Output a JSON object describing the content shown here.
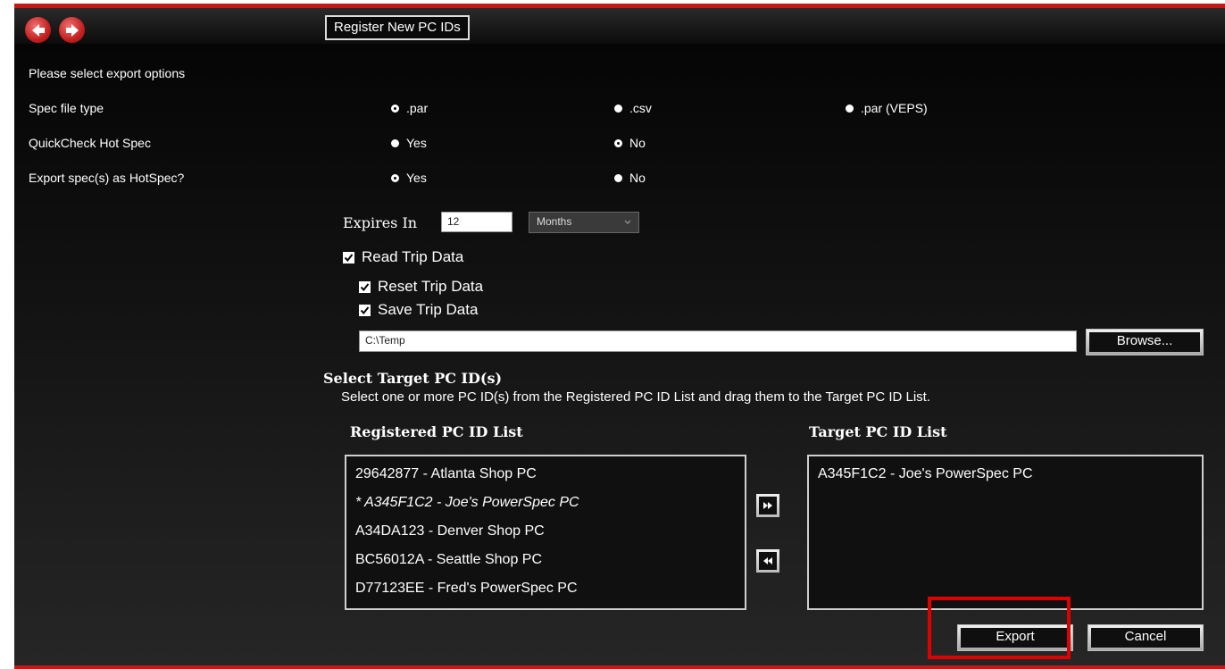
{
  "tab": {
    "title": "Register New PC IDs"
  },
  "options": {
    "heading": "Please select export options",
    "spec_file_type": {
      "label": "Spec file type",
      "choices": [
        ".par",
        ".csv",
        ".par (VEPS)"
      ],
      "selected": ".par"
    },
    "quickcheck_hot_spec": {
      "label": "QuickCheck Hot Spec",
      "choices": [
        "Yes",
        "No"
      ],
      "selected": "No"
    },
    "export_as_hotspec": {
      "label": "Export spec(s) as HotSpec?",
      "choices": [
        "Yes",
        "No"
      ],
      "selected": "Yes"
    }
  },
  "expires": {
    "label": "Expires In",
    "value": "12",
    "unit": "Months"
  },
  "trip": {
    "read": {
      "label": "Read Trip Data",
      "checked": true
    },
    "reset": {
      "label": "Reset Trip Data",
      "checked": true
    },
    "save": {
      "label": "Save Trip Data",
      "checked": true
    },
    "path": "C:\\Temp",
    "browse_label": "Browse..."
  },
  "target_section": {
    "title": "Select Target PC ID(s)",
    "instructions": "Select one or more PC ID(s) from the Registered PC ID List and drag them to the Target PC ID List."
  },
  "registered_list": {
    "title": "Registered PC ID List",
    "items": [
      "29642877 - Atlanta Shop PC",
      "* A345F1C2 - Joe's PowerSpec PC",
      "A34DA123 - Denver Shop PC",
      "BC56012A - Seattle Shop PC",
      "D77123EE - Fred's PowerSpec PC"
    ]
  },
  "target_list": {
    "title": "Target PC ID List",
    "items": [
      "A345F1C2 - Joe's PowerSpec PC"
    ]
  },
  "buttons": {
    "export": "Export",
    "cancel": "Cancel"
  },
  "colors": {
    "accent": "#c21a1a",
    "highlight": "#e00000",
    "background": "#000000"
  },
  "icons": [
    "back-arrow-icon",
    "forward-arrow-icon",
    "move-right-icon",
    "move-left-icon",
    "checkmark-icon",
    "chevron-down-icon"
  ]
}
